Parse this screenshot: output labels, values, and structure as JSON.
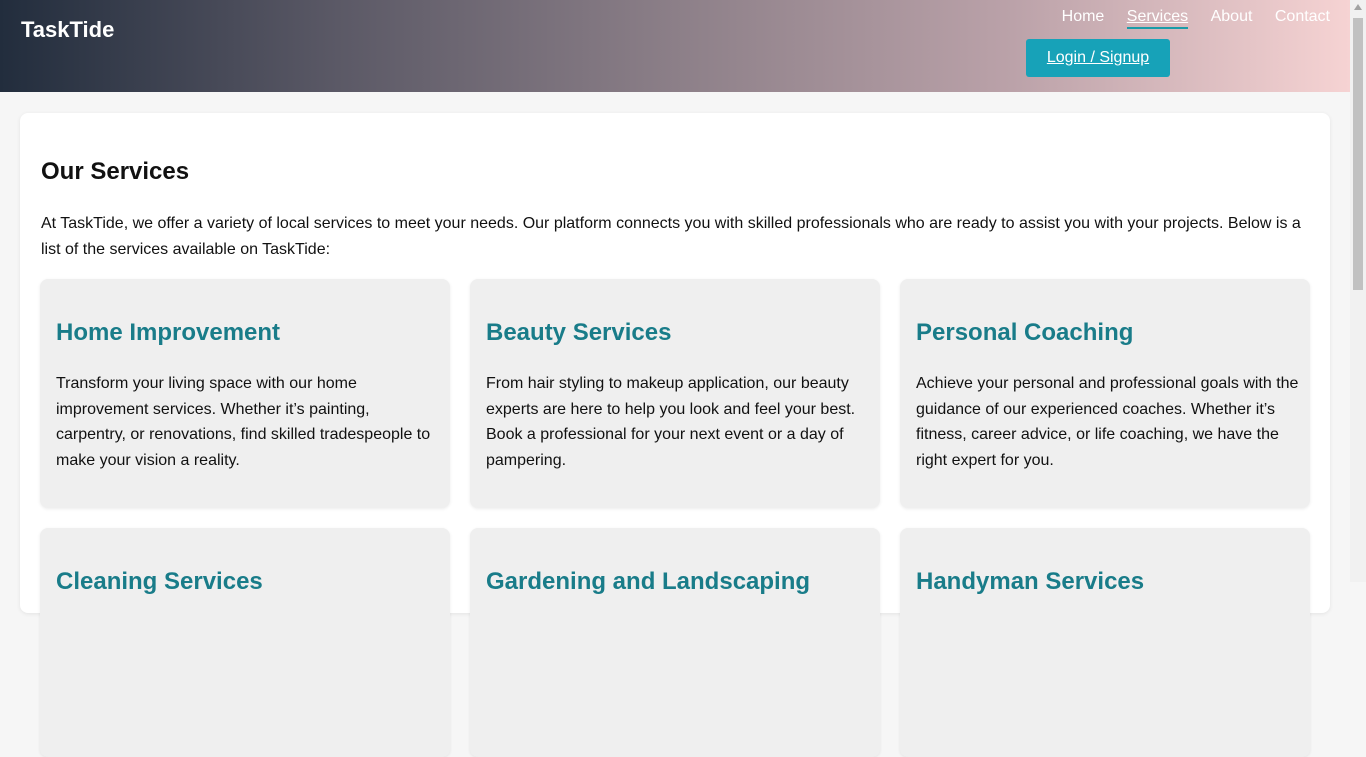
{
  "header": {
    "logo": "TaskTide",
    "nav": [
      "Home",
      "Services",
      "About",
      "Contact"
    ],
    "active_nav": "Services",
    "login_label": "Login / Signup"
  },
  "main": {
    "title": "Our Services",
    "intro": "At TaskTide, we offer a variety of local services to meet your needs. Our platform connects you with skilled professionals who are ready to assist you with your projects. Below is a list of the services available on TaskTide:",
    "services": [
      {
        "title": "Home Improvement",
        "desc": "Transform your living space with our home improvement services. Whether it’s painting, carpentry, or renovations, find skilled tradespeople to make your vision a reality."
      },
      {
        "title": "Beauty Services",
        "desc": "From hair styling to makeup application, our beauty experts are here to help you look and feel your best. Book a professional for your next event or a day of pampering."
      },
      {
        "title": "Personal Coaching",
        "desc": "Achieve your personal and professional goals with the guidance of our experienced coaches. Whether it’s fitness, career advice, or life coaching, we have the right expert for you."
      },
      {
        "title": "Cleaning Services",
        "desc": ""
      },
      {
        "title": "Gardening and Landscaping",
        "desc": ""
      },
      {
        "title": "Handyman Services",
        "desc": ""
      }
    ]
  }
}
